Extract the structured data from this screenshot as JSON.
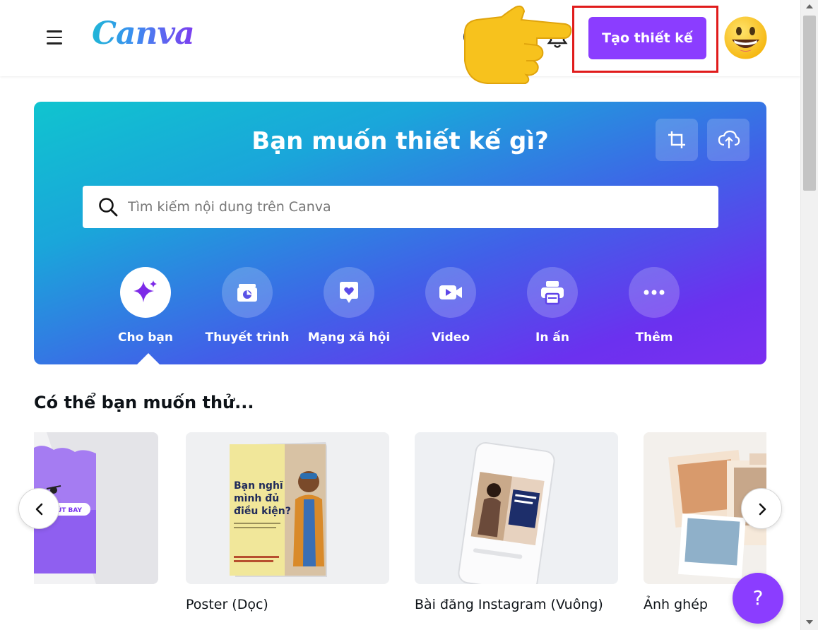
{
  "header": {
    "logo": "Canva",
    "create_button": "Tạo thiết kế",
    "brand_color": "#8b3dff",
    "highlight_color": "#e01b1b"
  },
  "hero": {
    "title": "Bạn muốn thiết kế gì?",
    "search_placeholder": "Tìm kiếm nội dung trên Canva",
    "gradient_start": "#10c4cf",
    "gradient_end": "#7b2ff0",
    "categories": [
      {
        "label": "Cho bạn",
        "icon": "sparkle-icon",
        "active": true
      },
      {
        "label": "Thuyết trình",
        "icon": "presentation-icon",
        "active": false
      },
      {
        "label": "Mạng xã hội",
        "icon": "heart-chat-icon",
        "active": false
      },
      {
        "label": "Video",
        "icon": "video-camera-icon",
        "active": false
      },
      {
        "label": "In ấn",
        "icon": "printer-icon",
        "active": false
      },
      {
        "label": "Thêm",
        "icon": "more-dots-icon",
        "active": false
      }
    ]
  },
  "suggestions": {
    "title": "Có thể bạn muốn thử...",
    "cards": [
      {
        "label": "",
        "thumb_text": "VÚT BAY"
      },
      {
        "label": "Poster (Dọc)",
        "thumb_text": "Bạn nghĩ mình đủ điều kiện?"
      },
      {
        "label": "Bài đăng Instagram (Vuông)"
      },
      {
        "label": "Ảnh ghép"
      }
    ]
  },
  "help_fab": "?"
}
